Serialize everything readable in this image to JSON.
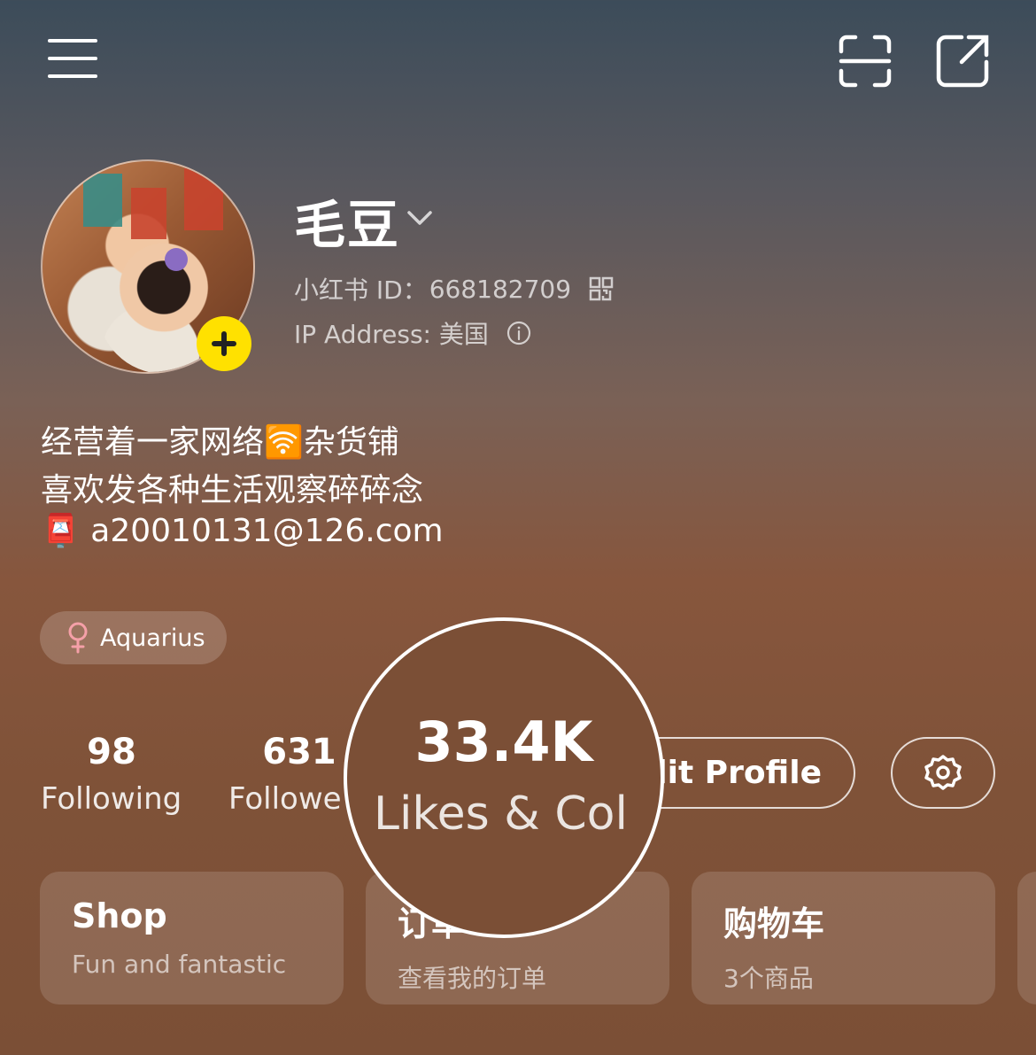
{
  "header": {
    "menu_icon": "hamburger-menu-icon",
    "scan_icon": "scan-icon",
    "share_icon": "share-icon"
  },
  "profile": {
    "name": "毛豆",
    "id_label": "小红书 ID：",
    "id_value": "668182709",
    "ip_label": "IP Address: 美国",
    "bio_line1": "经营着一家网络🛜杂货铺",
    "bio_line2": "喜欢发各种生活观察碎碎念",
    "bio_line3": "📮 a20010131@126.com",
    "tag": "Aquarius"
  },
  "stats": {
    "following_count": "98",
    "following_label": "Following",
    "followers_count": "631",
    "followers_label": "Followe",
    "likes_count": "33.4K",
    "likes_label": "Likes & Col"
  },
  "actions": {
    "edit_profile": "dit Profile"
  },
  "cards": [
    {
      "title": "Shop",
      "subtitle": "Fun and fantastic"
    },
    {
      "title": "订单",
      "subtitle": "查看我的订单"
    },
    {
      "title": "购物车",
      "subtitle": "3个商品"
    }
  ],
  "colors": {
    "accent_yellow": "#ffe100",
    "tag_female_pink": "#f5a0a8"
  }
}
